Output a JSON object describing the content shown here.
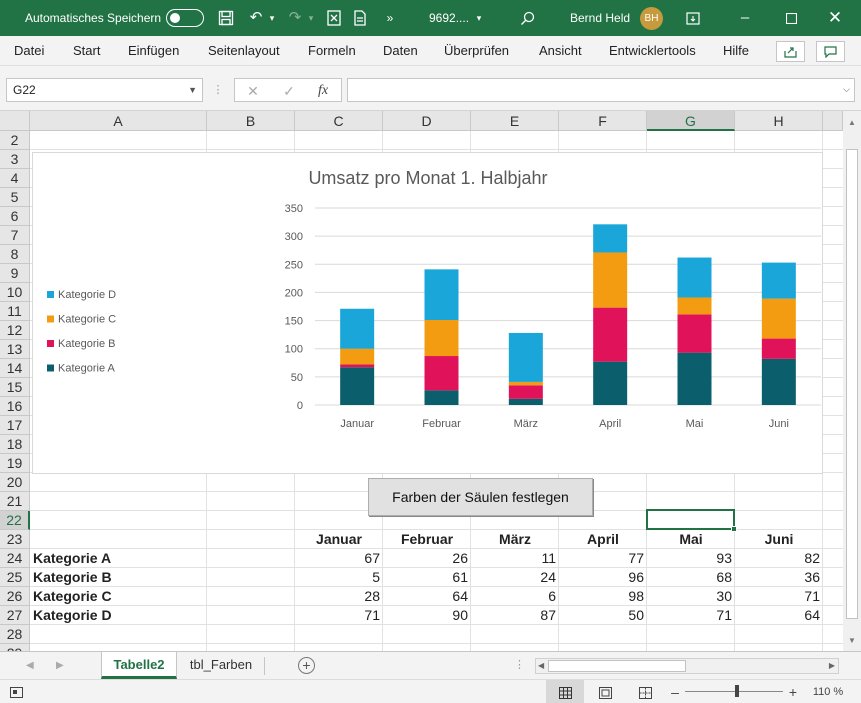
{
  "titlebar": {
    "autosave_label": "Automatisches Speichern",
    "filename": "9692....",
    "user_name": "Bernd Held",
    "user_initials": "BH"
  },
  "menu": [
    "Datei",
    "Start",
    "Einfügen",
    "Seitenlayout",
    "Formeln",
    "Daten",
    "Überprüfen",
    "Ansicht",
    "Entwicklertools",
    "Hilfe"
  ],
  "formula_bar": {
    "name_box": "G22",
    "fx": "fx",
    "formula": ""
  },
  "columns": [
    "A",
    "B",
    "C",
    "D",
    "E",
    "F",
    "G",
    "H"
  ],
  "selected_column": "G",
  "rows": [
    2,
    3,
    4,
    5,
    6,
    7,
    8,
    9,
    10,
    11,
    12,
    13,
    14,
    15,
    16,
    17,
    18,
    19,
    20,
    21,
    22,
    23,
    24,
    25,
    26,
    27,
    28,
    29
  ],
  "selected_row": 22,
  "table": {
    "header_months": [
      "Januar",
      "Februar",
      "März",
      "April",
      "Mai",
      "Juni"
    ],
    "categories": [
      {
        "name": "Kategorie A",
        "values": [
          67,
          26,
          11,
          77,
          93,
          82
        ]
      },
      {
        "name": "Kategorie B",
        "values": [
          5,
          61,
          24,
          96,
          68,
          36
        ]
      },
      {
        "name": "Kategorie C",
        "values": [
          28,
          64,
          6,
          98,
          30,
          71
        ]
      },
      {
        "name": "Kategorie D",
        "values": [
          71,
          90,
          87,
          50,
          71,
          64
        ]
      }
    ]
  },
  "macro_button_label": "Farben der Säulen festlegen",
  "sheet_tabs": [
    {
      "label": "Tabelle2",
      "active": true
    },
    {
      "label": "tbl_Farben",
      "active": false
    }
  ],
  "zoom": "110 %",
  "chart_data": {
    "type": "bar",
    "stacked": true,
    "title": "Umsatz pro Monat 1. Halbjahr",
    "categories": [
      "Januar",
      "Februar",
      "März",
      "April",
      "Mai",
      "Juni"
    ],
    "series": [
      {
        "name": "Kategorie A",
        "color": "#0b5e6b",
        "values": [
          67,
          26,
          11,
          77,
          93,
          82
        ]
      },
      {
        "name": "Kategorie B",
        "color": "#e0135a",
        "values": [
          5,
          61,
          24,
          96,
          68,
          36
        ]
      },
      {
        "name": "Kategorie C",
        "color": "#f39c11",
        "values": [
          28,
          64,
          6,
          98,
          30,
          71
        ]
      },
      {
        "name": "Kategorie D",
        "color": "#1ba6d9",
        "values": [
          71,
          90,
          87,
          50,
          71,
          64
        ]
      }
    ],
    "ylim": [
      0,
      350
    ],
    "yticks": [
      0,
      50,
      100,
      150,
      200,
      250,
      300,
      350
    ],
    "grid": true,
    "legend": "left"
  }
}
